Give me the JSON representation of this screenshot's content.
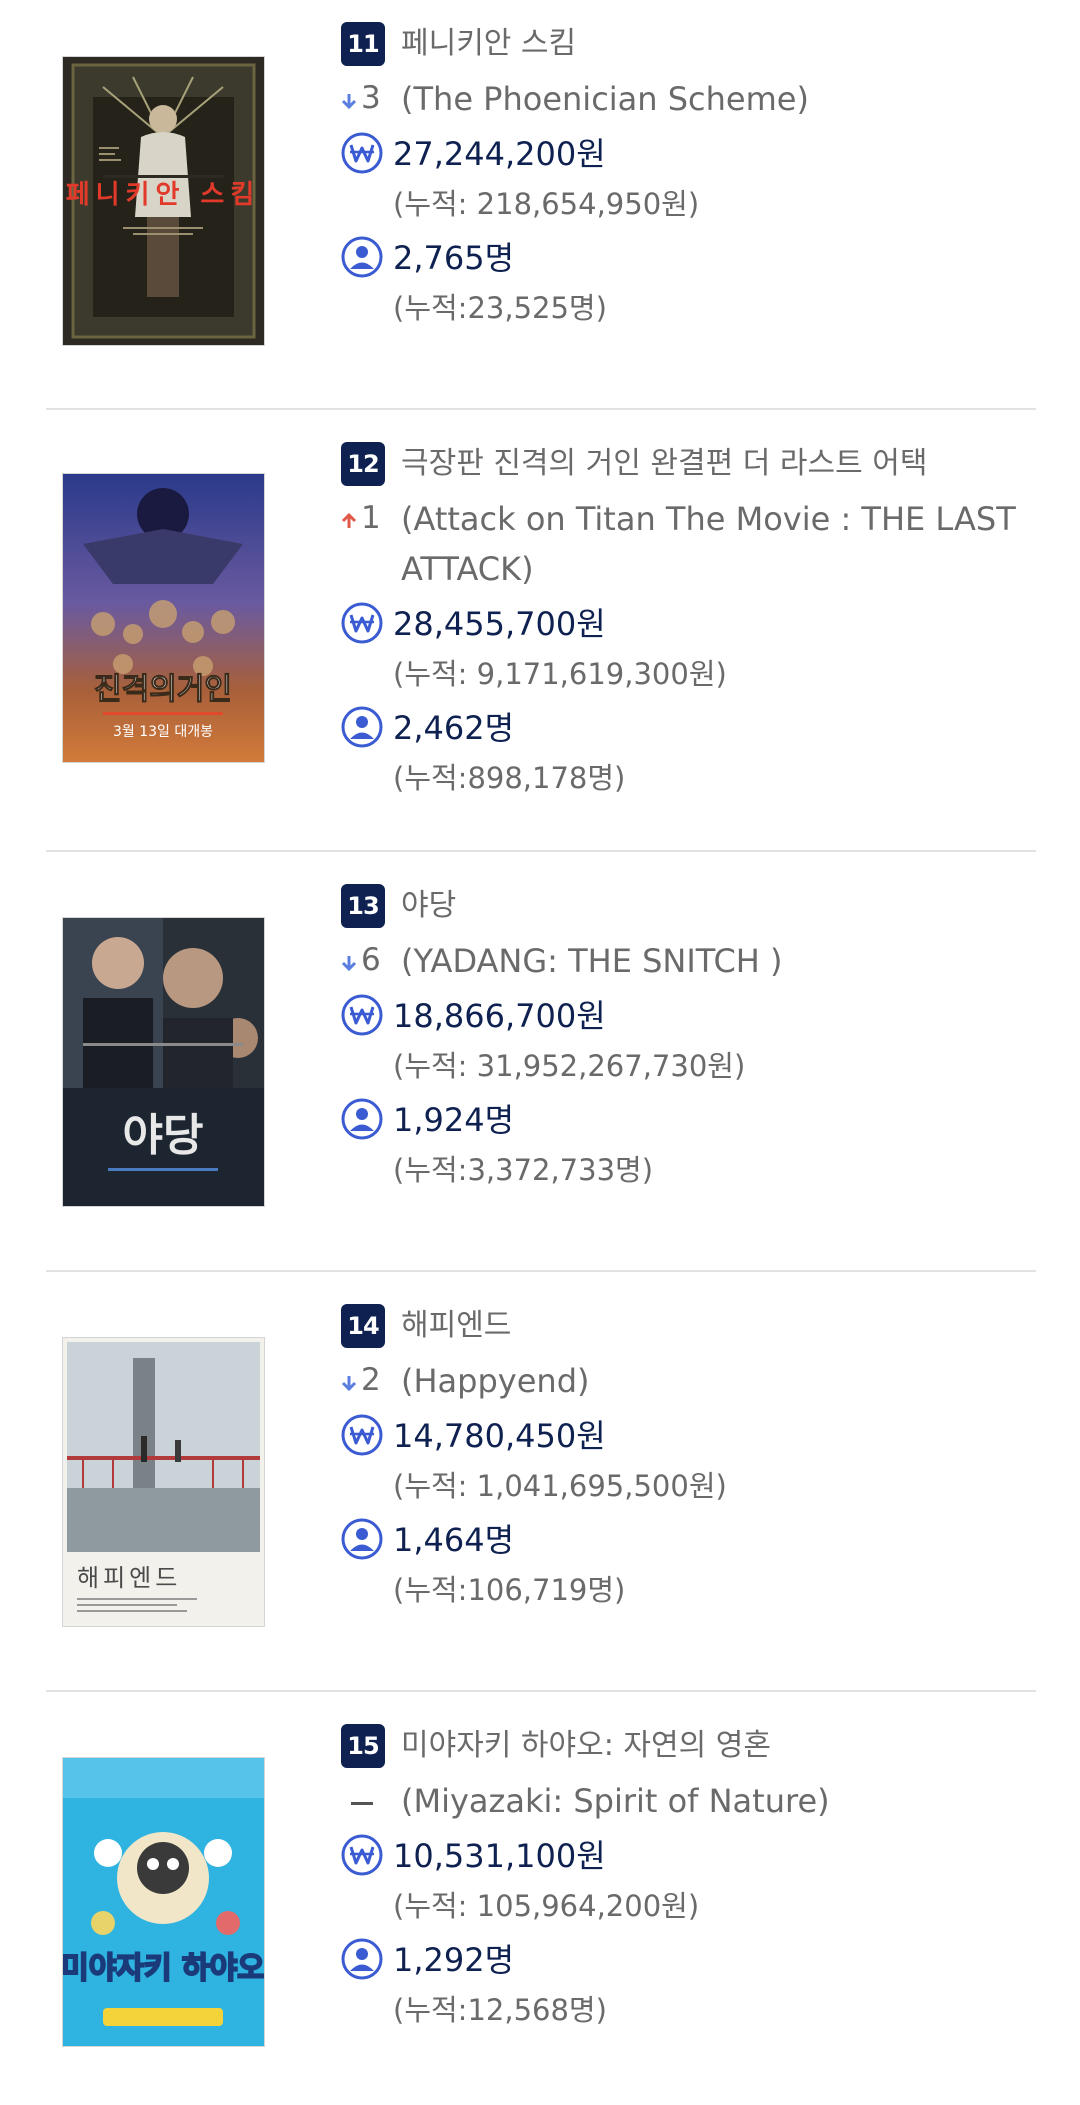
{
  "movies": [
    {
      "rank": "11",
      "title_ko": "페니키안 스킴",
      "change_dir": "down",
      "change_num": "3",
      "title_en": "(The Phoenician Scheme)",
      "sales": "27,244,200원",
      "sales_total": "(누적: 218,654,950원)",
      "audience": "2,765명",
      "audience_total": "(누적:23,525명)",
      "poster_text": "페니키안 스킴"
    },
    {
      "rank": "12",
      "title_ko": "극장판 진격의 거인 완결편 더 라스트 어택",
      "change_dir": "up",
      "change_num": "1",
      "title_en": "(Attack on Titan The Movie : THE LAST ATTACK)",
      "sales": "28,455,700원",
      "sales_total": "(누적: 9,171,619,300원)",
      "audience": "2,462명",
      "audience_total": "(누적:898,178명)",
      "poster_text": "진격의거인",
      "poster_sub": "3월 13일 대개봉"
    },
    {
      "rank": "13",
      "title_ko": "야당",
      "change_dir": "down",
      "change_num": "6",
      "title_en": "(YADANG: THE SNITCH )",
      "sales": "18,866,700원",
      "sales_total": "(누적: 31,952,267,730원)",
      "audience": "1,924명",
      "audience_total": "(누적:3,372,733명)",
      "poster_text": "야당"
    },
    {
      "rank": "14",
      "title_ko": "해피엔드",
      "change_dir": "down",
      "change_num": "2",
      "title_en": "(Happyend)",
      "sales": "14,780,450원",
      "sales_total": "(누적: 1,041,695,500원)",
      "audience": "1,464명",
      "audience_total": "(누적:106,719명)",
      "poster_text": "해피엔드"
    },
    {
      "rank": "15",
      "title_ko": "미야자키 하야오: 자연의 영혼",
      "change_dir": "same",
      "change_num": "",
      "title_en": "(Miyazaki: Spirit of Nature)",
      "sales": "10,531,100원",
      "sales_total": "(누적: 105,964,200원)",
      "audience": "1,292명",
      "audience_total": "(누적:12,568명)",
      "poster_text": "미야자키 하야오"
    }
  ],
  "colors": {
    "rank_badge": "#0e2150",
    "value_text": "#0e2150",
    "muted_text": "#6a6a6a",
    "icon_blue": "#3b5bd3",
    "arrow_down": "#5b7fe0",
    "arrow_up": "#e05a4a"
  },
  "icons": {
    "sales": "won-icon",
    "audience": "person-icon"
  }
}
